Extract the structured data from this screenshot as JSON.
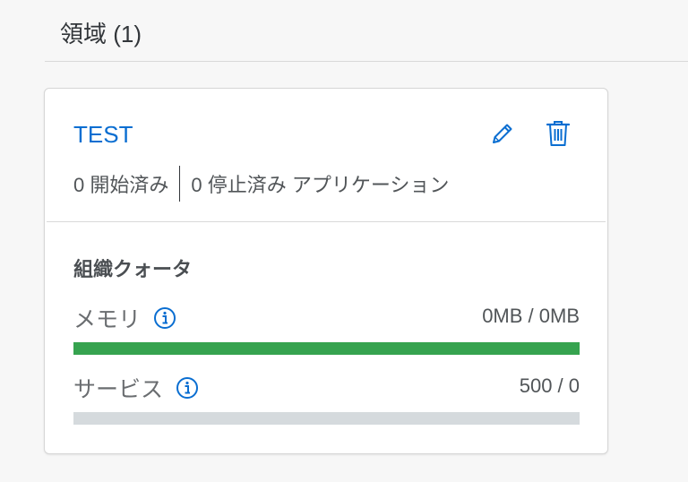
{
  "section": {
    "title": "領域 (1)"
  },
  "space_card": {
    "name": "TEST",
    "edit_icon": "pencil-icon",
    "delete_icon": "trash-icon",
    "started_apps": "0 開始済み",
    "stopped_apps": "0 停止済み アプリケーション",
    "quota": {
      "heading": "組織クォータ",
      "memory": {
        "label": "メモリ",
        "value": "0MB / 0MB",
        "fill_percent": 100,
        "bar_color": "#36a34f"
      },
      "services": {
        "label": "サービス",
        "value": "500 / 0",
        "fill_percent": 0,
        "bar_color": "#36a34f"
      }
    }
  },
  "colors": {
    "link": "#0a6ed1",
    "bar_track": "#d5dadd"
  }
}
